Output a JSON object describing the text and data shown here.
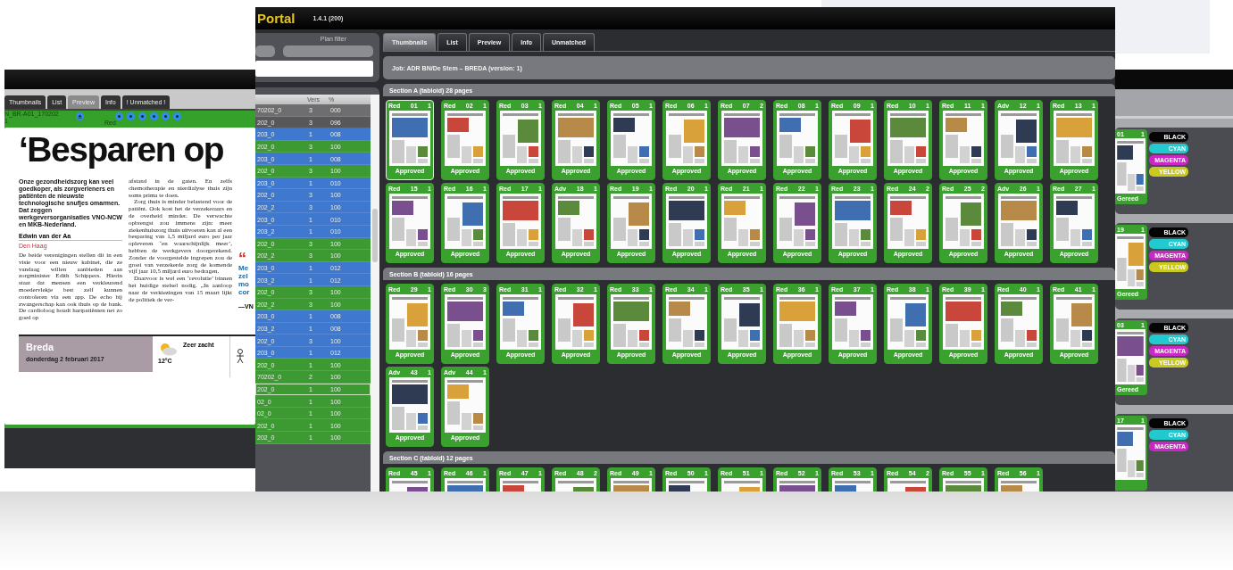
{
  "preview_window": {
    "tabs": [
      {
        "label": "Thumbnails",
        "selected": false
      },
      {
        "label": "List",
        "selected": false
      },
      {
        "label": "Preview",
        "selected": true
      },
      {
        "label": "Info",
        "selected": false
      },
      {
        "label": "! Unmatched !",
        "selected": false
      }
    ],
    "file_name": "N_BR-A01_170202",
    "file_line_2": "1",
    "nav_label": "Red",
    "article": {
      "headline": "‘Besparen op",
      "lead": "Onze gezondheidszorg kan veel goedkoper, als zorgverleners en patiënten de nieuwste technologische snufjes omarmen. Dat zeggen werkgeversorganisaties VNO-NCW en MKB-Nederland.",
      "author": "Edwin van der Aa",
      "place": "Den Haag",
      "column_1": [
        "De beide verenigingen stellen dit in een visie voor een nieuw kabinet, die ze vandaag willen aanbieden aan zorgminister Edith Schippers. Hierin staat dat mensen een verkleurend moedervlekje best zelf kunnen controleren via een app. De echo bij zwangerschap kan ook thuis op de bank. De cardioloog houdt hartpatiënten net zo goed op"
      ],
      "column_2": [
        "afstand in de gaten. En zelfs chemotherapie en nierdialyse thuis zijn soms prima te doen.",
        "Zorg thuis is minder belastend voor de patiënt. Ook kost het de verzekeraars en de overheid minder. De verwachte opbrengst zou immens zijn: meer ziekenhuiszorg thuis uitvoeren kan al een besparing van 1,5 miljard euro per jaar opleveren ‘en waarschijnlijk meer’, hebben de werkgevers doorgerekend. Zonder de voorgestelde ingrepen zou de groei van verzekerde zorg de komende vijf jaar 10,5 miljard euro bedragen.",
        "Daarvoor is wel een ‘revolutie’ binnen het huidige stelsel nodig. „In aanloop naar de verkiezingen van 15 maart lijkt de politiek de ver-"
      ],
      "quote_mark": "“",
      "quote_lines": [
        "Me",
        "zel",
        "mo",
        "cor"
      ],
      "quote_source": "—VN",
      "city": "Breda",
      "date": "donderdag 2 februari 2017",
      "weather": "Zeer zacht",
      "temperature": "12°C"
    }
  },
  "main_window": {
    "title": "Portal",
    "version": "1.4.1 (200)",
    "plan_filter": {
      "label": "Plan filter"
    },
    "list": {
      "columns": [
        "Vers",
        "%"
      ],
      "rows": [
        {
          "name": "70202_0",
          "vers": "3",
          "percent": "000",
          "color": "#6e6e70",
          "selected": false
        },
        {
          "name": "202_0",
          "vers": "3",
          "percent": "096",
          "color": "#58585b",
          "selected": false
        },
        {
          "name": "203_0",
          "vers": "1",
          "percent": "008",
          "color": "#3f78cf",
          "selected": false
        },
        {
          "name": "202_0",
          "vers": "3",
          "percent": "100",
          "color": "#3d9a32",
          "selected": false
        },
        {
          "name": "203_0",
          "vers": "1",
          "percent": "008",
          "color": "#3f78cf",
          "selected": false
        },
        {
          "name": "202_0",
          "vers": "3",
          "percent": "100",
          "color": "#3d9a32",
          "selected": false
        },
        {
          "name": "203_0",
          "vers": "1",
          "percent": "010",
          "color": "#3f78cf",
          "selected": false
        },
        {
          "name": "202_0",
          "vers": "3",
          "percent": "100",
          "color": "#3f78cf",
          "selected": false
        },
        {
          "name": "202_2",
          "vers": "3",
          "percent": "100",
          "color": "#3f78cf",
          "selected": false
        },
        {
          "name": "203_0",
          "vers": "1",
          "percent": "010",
          "color": "#3f78cf",
          "selected": false
        },
        {
          "name": "203_2",
          "vers": "1",
          "percent": "010",
          "color": "#3f78cf",
          "selected": false
        },
        {
          "name": "202_0",
          "vers": "3",
          "percent": "100",
          "color": "#3d9a32",
          "selected": false
        },
        {
          "name": "202_2",
          "vers": "3",
          "percent": "100",
          "color": "#3d9a32",
          "selected": false
        },
        {
          "name": "203_0",
          "vers": "1",
          "percent": "012",
          "color": "#3f78cf",
          "selected": false
        },
        {
          "name": "203_2",
          "vers": "1",
          "percent": "012",
          "color": "#3f78cf",
          "selected": false
        },
        {
          "name": "202_0",
          "vers": "3",
          "percent": "100",
          "color": "#3d9a32",
          "selected": false
        },
        {
          "name": "202_2",
          "vers": "3",
          "percent": "100",
          "color": "#3d9a32",
          "selected": false
        },
        {
          "name": "203_0",
          "vers": "1",
          "percent": "008",
          "color": "#3f78cf",
          "selected": false
        },
        {
          "name": "203_2",
          "vers": "1",
          "percent": "008",
          "color": "#3f78cf",
          "selected": false
        },
        {
          "name": "202_0",
          "vers": "3",
          "percent": "100",
          "color": "#3f78cf",
          "selected": false
        },
        {
          "name": "203_0",
          "vers": "1",
          "percent": "012",
          "color": "#3f78cf",
          "selected": false
        },
        {
          "name": "202_0",
          "vers": "1",
          "percent": "100",
          "color": "#3d9a32",
          "selected": false
        },
        {
          "name": "70202_0",
          "vers": "2",
          "percent": "100",
          "color": "#3d9a32",
          "selected": false
        },
        {
          "name": "202_0",
          "vers": "1",
          "percent": "100",
          "color": "#3d9a32",
          "selected": true
        },
        {
          "name": "02_0",
          "vers": "1",
          "percent": "100",
          "color": "#3d9a32",
          "selected": false
        },
        {
          "name": "02_0",
          "vers": "1",
          "percent": "100",
          "color": "#3d9a32",
          "selected": false
        },
        {
          "name": "202_0",
          "vers": "1",
          "percent": "100",
          "color": "#3d9a32",
          "selected": false
        },
        {
          "name": "202_0",
          "vers": "1",
          "percent": "100",
          "color": "#3d9a32",
          "selected": false
        }
      ]
    },
    "tabs": [
      {
        "label": "Thumbnails",
        "selected": true
      },
      {
        "label": "List",
        "selected": false
      },
      {
        "label": "Preview",
        "selected": false
      },
      {
        "label": "Info",
        "selected": false
      },
      {
        "label": "Unmatched",
        "selected": false
      }
    ],
    "job": "Job: ADR BN/De Stem – BREDA (version: 1)",
    "sections": [
      {
        "title": "Section A (tabloid) 28 pages",
        "pages": [
          {
            "type": "Red",
            "page": "01",
            "revision": "1",
            "status": "Approved",
            "selected": true
          },
          {
            "type": "Red",
            "page": "02",
            "revision": "1",
            "status": "Approved",
            "selected": false
          },
          {
            "type": "Red",
            "page": "03",
            "revision": "1",
            "status": "Approved",
            "selected": false
          },
          {
            "type": "Red",
            "page": "04",
            "revision": "1",
            "status": "Approved",
            "selected": false
          },
          {
            "type": "Red",
            "page": "05",
            "revision": "1",
            "status": "Approved",
            "selected": false
          },
          {
            "type": "Red",
            "page": "06",
            "revision": "1",
            "status": "Approved",
            "selected": false
          },
          {
            "type": "Red",
            "page": "07",
            "revision": "2",
            "status": "Approved",
            "selected": false
          },
          {
            "type": "Red",
            "page": "08",
            "revision": "1",
            "status": "Approved",
            "selected": false
          },
          {
            "type": "Red",
            "page": "09",
            "revision": "1",
            "status": "Approved",
            "selected": false
          },
          {
            "type": "Red",
            "page": "10",
            "revision": "1",
            "status": "Approved",
            "selected": false
          },
          {
            "type": "Red",
            "page": "11",
            "revision": "1",
            "status": "Approved",
            "selected": false
          },
          {
            "type": "Adv",
            "page": "12",
            "revision": "1",
            "status": "Approved",
            "selected": false
          },
          {
            "type": "Red",
            "page": "13",
            "revision": "1",
            "status": "Approved",
            "selected": false
          },
          {
            "type": "Red",
            "page": "15",
            "revision": "1",
            "status": "Approved",
            "selected": false
          },
          {
            "type": "Red",
            "page": "16",
            "revision": "1",
            "status": "Approved",
            "selected": false
          },
          {
            "type": "Red",
            "page": "17",
            "revision": "1",
            "status": "Approved",
            "selected": false
          },
          {
            "type": "Adv",
            "page": "18",
            "revision": "1",
            "status": "Approved",
            "selected": false
          },
          {
            "type": "Red",
            "page": "19",
            "revision": "1",
            "status": "Approved",
            "selected": false
          },
          {
            "type": "Red",
            "page": "20",
            "revision": "1",
            "status": "Approved",
            "selected": false
          },
          {
            "type": "Red",
            "page": "21",
            "revision": "1",
            "status": "Approved",
            "selected": false
          },
          {
            "type": "Red",
            "page": "22",
            "revision": "1",
            "status": "Approved",
            "selected": false
          },
          {
            "type": "Red",
            "page": "23",
            "revision": "1",
            "status": "Approved",
            "selected": false
          },
          {
            "type": "Red",
            "page": "24",
            "revision": "2",
            "status": "Approved",
            "selected": false
          },
          {
            "type": "Red",
            "page": "25",
            "revision": "2",
            "status": "Approved",
            "selected": false
          },
          {
            "type": "Adv",
            "page": "26",
            "revision": "1",
            "status": "Approved",
            "selected": false
          },
          {
            "type": "Red",
            "page": "27",
            "revision": "1",
            "status": "Approved",
            "selected": false
          }
        ]
      },
      {
        "title": "Section B (tabloid) 16 pages",
        "pages": [
          {
            "type": "Red",
            "page": "29",
            "revision": "1",
            "status": "Approved",
            "selected": false
          },
          {
            "type": "Red",
            "page": "30",
            "revision": "3",
            "status": "Approved",
            "selected": false
          },
          {
            "type": "Red",
            "page": "31",
            "revision": "1",
            "status": "Approved",
            "selected": false
          },
          {
            "type": "Red",
            "page": "32",
            "revision": "1",
            "status": "Approved",
            "selected": false
          },
          {
            "type": "Red",
            "page": "33",
            "revision": "1",
            "status": "Approved",
            "selected": false
          },
          {
            "type": "Red",
            "page": "34",
            "revision": "1",
            "status": "Approved",
            "selected": false
          },
          {
            "type": "Red",
            "page": "35",
            "revision": "1",
            "status": "Approved",
            "selected": false
          },
          {
            "type": "Red",
            "page": "36",
            "revision": "1",
            "status": "Approved",
            "selected": false
          },
          {
            "type": "Red",
            "page": "37",
            "revision": "1",
            "status": "Approved",
            "selected": false
          },
          {
            "type": "Red",
            "page": "38",
            "revision": "1",
            "status": "Approved",
            "selected": false
          },
          {
            "type": "Red",
            "page": "39",
            "revision": "1",
            "status": "Approved",
            "selected": false
          },
          {
            "type": "Red",
            "page": "40",
            "revision": "1",
            "status": "Approved",
            "selected": false
          },
          {
            "type": "Red",
            "page": "41",
            "revision": "1",
            "status": "Approved",
            "selected": false
          },
          {
            "type": "Adv",
            "page": "43",
            "revision": "1",
            "status": "Approved",
            "selected": false
          },
          {
            "type": "Adv",
            "page": "44",
            "revision": "1",
            "status": "Approved",
            "selected": false
          }
        ]
      },
      {
        "title": "Section C (tabloid) 12 pages",
        "pages": [
          {
            "type": "Red",
            "page": "45",
            "revision": "1",
            "selected": false
          },
          {
            "type": "Red",
            "page": "46",
            "revision": "1",
            "selected": false
          },
          {
            "type": "Red",
            "page": "47",
            "revision": "1",
            "selected": false
          },
          {
            "type": "Red",
            "page": "48",
            "revision": "2",
            "selected": false
          },
          {
            "type": "Red",
            "page": "49",
            "revision": "1",
            "selected": false
          },
          {
            "type": "Red",
            "page": "50",
            "revision": "1",
            "selected": false
          },
          {
            "type": "Red",
            "page": "51",
            "revision": "1",
            "selected": false
          },
          {
            "type": "Red",
            "page": "52",
            "revision": "1",
            "selected": false
          },
          {
            "type": "Red",
            "page": "53",
            "revision": "1",
            "selected": false
          },
          {
            "type": "Red",
            "page": "54",
            "revision": "2",
            "selected": false
          },
          {
            "type": "Red",
            "page": "55",
            "revision": "1",
            "selected": false
          },
          {
            "type": "Red",
            "page": "56",
            "revision": "1",
            "selected": false
          }
        ]
      }
    ]
  },
  "plates_window": {
    "pages": [
      {
        "page": "01",
        "revision": "1",
        "status": "Gereed",
        "inks": [
          {
            "label": "BLACK",
            "color": "#050505"
          },
          {
            "label": "CYAN",
            "color": "#22c9cf"
          },
          {
            "label": "MAGENTA",
            "color": "#c928c4"
          },
          {
            "label": "YELLOW",
            "color": "#c9c920"
          }
        ]
      },
      {
        "page": "19",
        "revision": "1",
        "status": "Gereed",
        "inks": [
          {
            "label": "BLACK",
            "color": "#050505"
          },
          {
            "label": "CYAN",
            "color": "#22c9cf"
          },
          {
            "label": "MAGENTA",
            "color": "#c928c4"
          },
          {
            "label": "YELLOW",
            "color": "#c9c920"
          }
        ]
      },
      {
        "page": "03",
        "revision": "1",
        "status": "Gereed",
        "inks": [
          {
            "label": "BLACK",
            "color": "#050505"
          },
          {
            "label": "CYAN",
            "color": "#22c9cf"
          },
          {
            "label": "MAGENTA",
            "color": "#c928c4"
          },
          {
            "label": "YELLOW",
            "color": "#c9c920"
          }
        ]
      },
      {
        "page": "17",
        "revision": "1",
        "inks": [
          {
            "label": "BLACK",
            "color": "#050505"
          },
          {
            "label": "CYAN",
            "color": "#22c9cf"
          },
          {
            "label": "MAGENTA",
            "color": "#c928c4"
          }
        ]
      }
    ]
  }
}
